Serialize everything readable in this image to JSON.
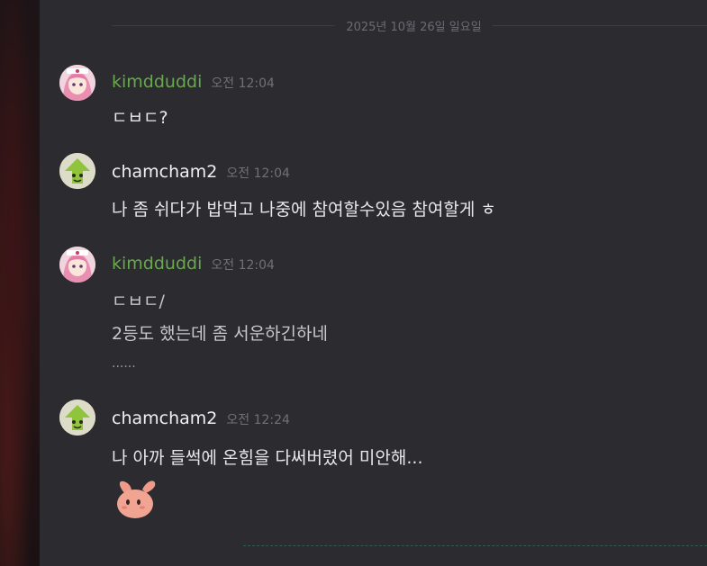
{
  "divider": {
    "date": "2025년 10월 26일 일요일"
  },
  "messages": [
    {
      "author": "kimdduddi",
      "time": "오전 12:04",
      "lines": [
        "ㄷㅂㄷ?"
      ]
    },
    {
      "author": "chamcham2",
      "time": "오전 12:04",
      "lines": [
        "나 좀 쉬다가 밥먹고 나중에 참여할수있음 참여할게 ㅎ"
      ]
    },
    {
      "author": "kimdduddi",
      "time": "오전 12:04",
      "lines": [
        "ㄷㅂㄷ/",
        "2등도 했는데 좀 서운하긴하네",
        "......"
      ]
    },
    {
      "author": "chamcham2",
      "time": "오전 12:24",
      "lines": [
        "나 아까 들썩에 온힘을 다써버렸어 미안해..."
      ]
    }
  ],
  "colors": {
    "kimdduddi_name": "#6aa84f",
    "chamcham2_name": "#f0f0f0",
    "background": "#2b2b30"
  },
  "icons": {
    "avatar_kimdduddi": "pink-hair-girl-avatar",
    "avatar_chamcham2": "green-frog-avatar",
    "sticker": "pink-bunny-sticker"
  }
}
